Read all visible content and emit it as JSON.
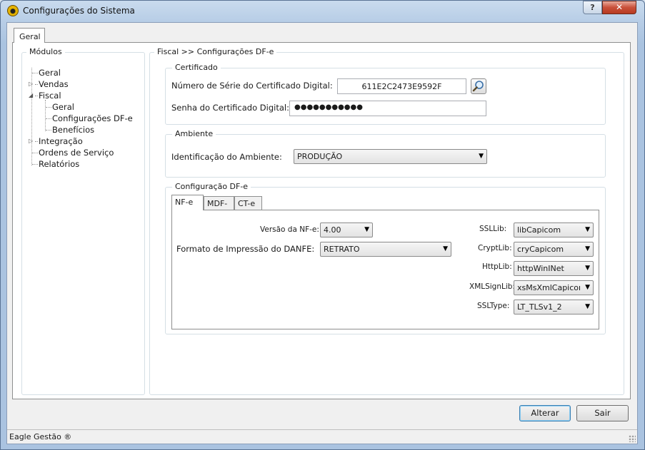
{
  "window": {
    "title": "Configurações do Sistema",
    "help_label": "?",
    "close_label": "✕"
  },
  "main_tab": {
    "label": "Geral"
  },
  "tree": {
    "title": "Módulos",
    "items": [
      {
        "label": "Geral"
      },
      {
        "label": "Vendas"
      },
      {
        "label": "Fiscal"
      },
      {
        "label": "Geral"
      },
      {
        "label": "Configurações DF-e"
      },
      {
        "label": "Benefícios"
      },
      {
        "label": "Integração"
      },
      {
        "label": "Ordens de Serviço"
      },
      {
        "label": "Relatórios"
      }
    ]
  },
  "content": {
    "breadcrumb": "Fiscal >> Configurações DF-e",
    "certificado": {
      "title": "Certificado",
      "serial_label": "Número de Série do Certificado Digital:",
      "serial_value": "611E2C2473E9592F",
      "password_label": "Senha do Certificado Digital:",
      "password_value": "●●●●●●●●●●●"
    },
    "ambiente": {
      "title": "Ambiente",
      "label": "Identificação do Ambiente:",
      "value": "PRODUÇÃO"
    },
    "dfe": {
      "title": "Configuração DF-e",
      "tabs": [
        {
          "label": "NF-e"
        },
        {
          "label": "MDF-e"
        },
        {
          "label": "CT-e"
        }
      ],
      "versao_label": "Versão da NF-e:",
      "versao_value": "4.00",
      "formato_label": "Formato de Impressão do DANFE:",
      "formato_value": "RETRATO",
      "ssllib_label": "SSLLib:",
      "ssllib_value": "libCapicom",
      "cryptlib_label": "CryptLib:",
      "cryptlib_value": "cryCapicom",
      "httplib_label": "HttpLib:",
      "httplib_value": "httpWinINet",
      "xmlsignlib_label": "XMLSignLib:",
      "xmlsignlib_value": "xsMsXmlCapicom",
      "ssltype_label": "SSLType:",
      "ssltype_value": "LT_TLSv1_2"
    }
  },
  "buttons": {
    "alterar": "Alterar",
    "sair": "Sair"
  },
  "status": {
    "text": "Eagle Gestão ®"
  },
  "icons": {
    "app": "eagle-app-icon",
    "search": "magnifier-icon",
    "expand": "triangle-right-icon",
    "collapse": "triangle-down-icon"
  }
}
